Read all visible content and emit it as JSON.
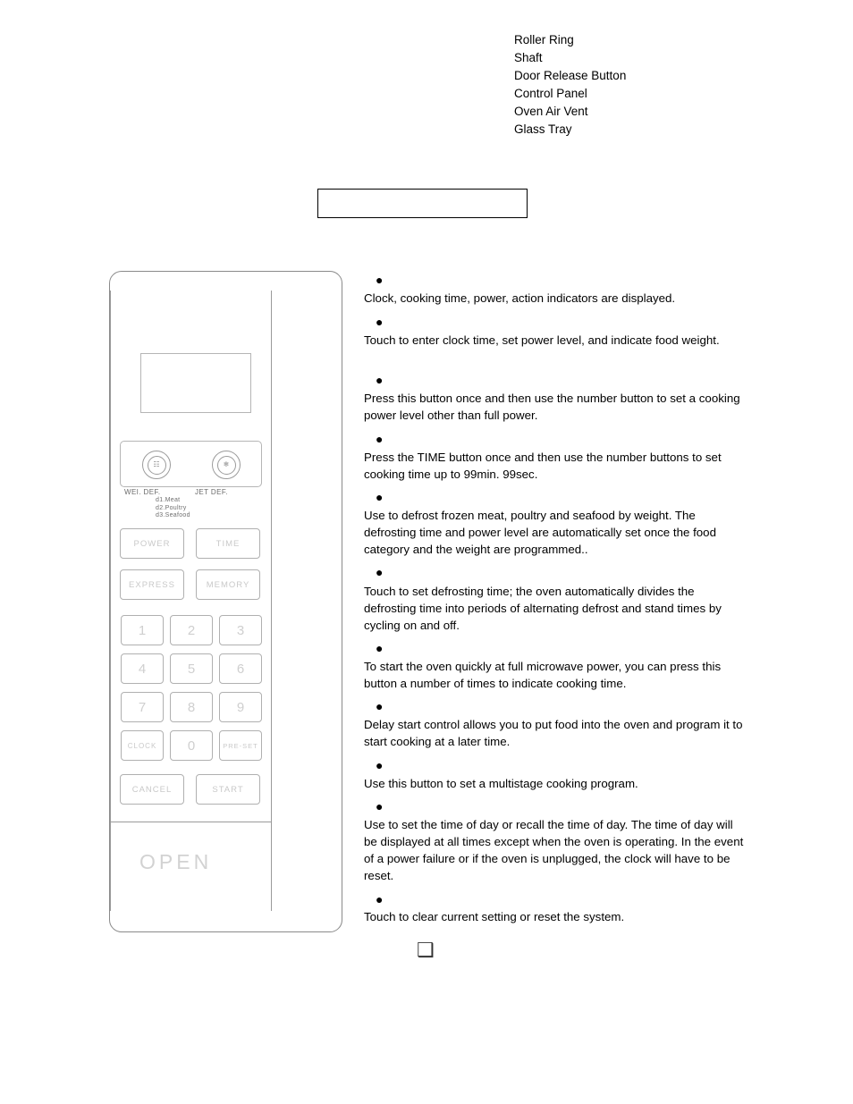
{
  "parts_list": [
    "Roller Ring",
    "Shaft",
    "Door Release Button",
    "Control Panel",
    "Oven Air Vent",
    "Glass Tray"
  ],
  "callout_box": {
    "text": ""
  },
  "control_panel": {
    "display_window_label": "",
    "defrost": {
      "left_dial_label": "WEI. DEF.",
      "right_dial_label": "JET DEF.",
      "categories": [
        "d1.Meat",
        "d2.Poultry",
        "d3.Seafood"
      ]
    },
    "buttons": [
      {
        "label": "POWER"
      },
      {
        "label": "TIME"
      },
      {
        "label": "EXPRESS"
      },
      {
        "label": "MEMORY"
      },
      {
        "label": "1"
      },
      {
        "label": "2"
      },
      {
        "label": "3"
      },
      {
        "label": "4"
      },
      {
        "label": "5"
      },
      {
        "label": "6"
      },
      {
        "label": "7"
      },
      {
        "label": "8"
      },
      {
        "label": "9"
      },
      {
        "label": "CLOCK"
      },
      {
        "label": "0"
      },
      {
        "label": "PRE-SET"
      },
      {
        "label": "CANCEL"
      },
      {
        "label": "START"
      }
    ],
    "open_label": "OPEN"
  },
  "descriptions": [
    {
      "bullet": "●",
      "text": "Clock, cooking time, power, action indicators are displayed."
    },
    {
      "bullet": "●",
      "text": "Touch to enter clock time, set power level, and indicate food weight."
    },
    {
      "bullet": "●",
      "text": "Press this button once and then use the number button to set a cooking power level other than full power."
    },
    {
      "bullet": "●",
      "text": "Press the TIME button once and then use the number buttons to set cooking time up to 99min. 99sec."
    },
    {
      "bullet": "●",
      "text": "Use to defrost frozen meat, poultry and seafood by weight. The defrosting time and power level are automatically set once the food category and the weight are programmed.."
    },
    {
      "bullet": "●",
      "text": "Touch to set defrosting time; the oven automatically divides the defrosting time into periods of alternating defrost and stand times by cycling on and off."
    },
    {
      "bullet": "●",
      "text": "To start the oven quickly at full microwave power, you can press this button a number of times to indicate cooking time."
    },
    {
      "bullet": "●",
      "text": "Delay start control allows you to put food into the oven and program it to start cooking at a later time."
    },
    {
      "bullet": "●",
      "text": "Use this button to set a multistage cooking program."
    },
    {
      "bullet": "●",
      "text": "Use to set the time of day or recall the time of day. The time of day will be displayed at all times except when the oven is operating. In the event of a power failure or if the oven is unplugged, the clock will have to be reset."
    },
    {
      "bullet": "●",
      "text": "Touch to clear current setting or reset the system."
    }
  ],
  "footer_glyph": "❑"
}
